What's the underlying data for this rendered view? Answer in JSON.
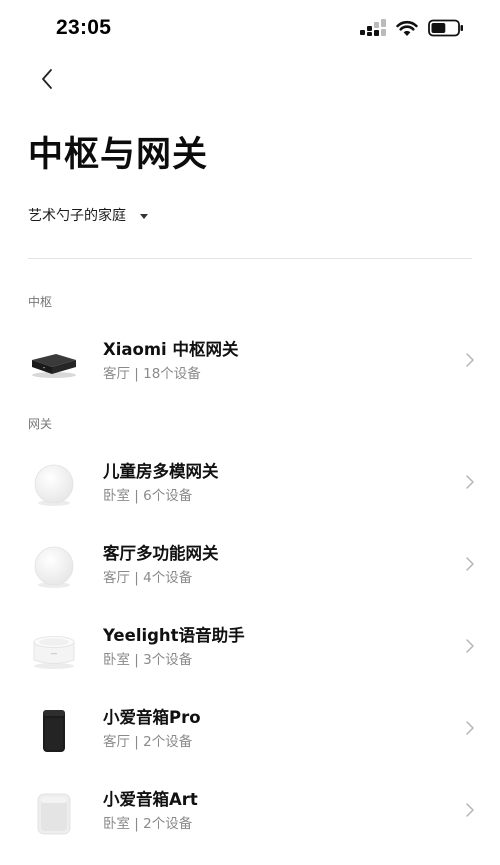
{
  "status_bar": {
    "time": "23:05",
    "icons": [
      "cellular-signal-icon",
      "wifi-icon",
      "battery-icon"
    ],
    "battery_level": 0.55
  },
  "header": {
    "back_icon": "chevron-left-icon",
    "title": "中枢与网关"
  },
  "home_selector": {
    "label": "艺术勺子的家庭",
    "icon": "dropdown-triangle-icon"
  },
  "sections": [
    {
      "label": "中枢",
      "devices": [
        {
          "name": "Xiaomi 中枢网关",
          "subtitle": "客厅 | 18个设备",
          "image": "hub-gateway-box"
        }
      ]
    },
    {
      "label": "网关",
      "devices": [
        {
          "name": "儿童房多模网关",
          "subtitle": "卧室 | 6个设备",
          "image": "round-white-gateway"
        },
        {
          "name": "客厅多功能网关",
          "subtitle": "客厅 | 4个设备",
          "image": "round-white-gateway"
        },
        {
          "name": "Yeelight语音助手",
          "subtitle": "卧室 | 3个设备",
          "image": "yeelight-speaker"
        },
        {
          "name": "小爱音箱Pro",
          "subtitle": "客厅 | 2个设备",
          "image": "black-tall-speaker"
        },
        {
          "name": "小爱音箱Art",
          "subtitle": "卧室 | 2个设备",
          "image": "white-square-speaker"
        }
      ]
    }
  ],
  "colors": {
    "title": "#0c0c0c",
    "secondary_text": "#8a8a8a",
    "divider": "#e4e4e4",
    "chevron": "#b5b5b5"
  }
}
